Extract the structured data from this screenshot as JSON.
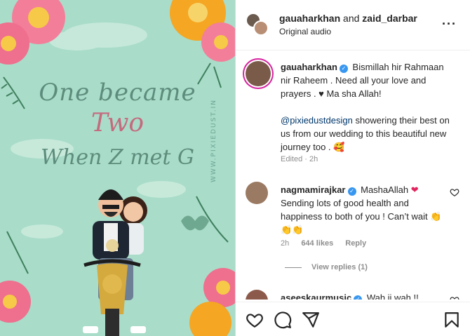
{
  "media": {
    "title_line1": "One became",
    "title_line2": "Two",
    "title_line3": "When Z met G",
    "watermark": "WWW.PIXIEDUST.IN"
  },
  "header": {
    "user1": "gauaharkhan",
    "and_text": "and",
    "user2": "zaid_darbar",
    "audio": "Original audio",
    "more_icon": "more-horizontal-icon"
  },
  "caption": {
    "username": "gauaharkhan",
    "text1": "Bismillah hir Rahmaan nir Raheem . Need all your love and prayers . ♥ Ma sha Allah!",
    "mention": "@pixiedustdesign",
    "text2": "showering their best on us from our wedding to this beautiful new journey too .",
    "emoji": "🥰",
    "edited": "Edited · 2h"
  },
  "comments": [
    {
      "username": "nagmamirajkar",
      "text": "MashaAllah",
      "emoji": "❤",
      "text2": "Sending lots of good health and happiness to both of you ! Can’t wait 👏👏👏",
      "time": "2h",
      "likes": "644 likes",
      "reply": "Reply",
      "view_replies": "View replies (1)"
    },
    {
      "username": "aseeskaurmusic",
      "text": "Wah ji wah !!"
    }
  ],
  "actions": [
    "heart-icon",
    "comment-icon",
    "share-icon",
    "bookmark-icon"
  ]
}
